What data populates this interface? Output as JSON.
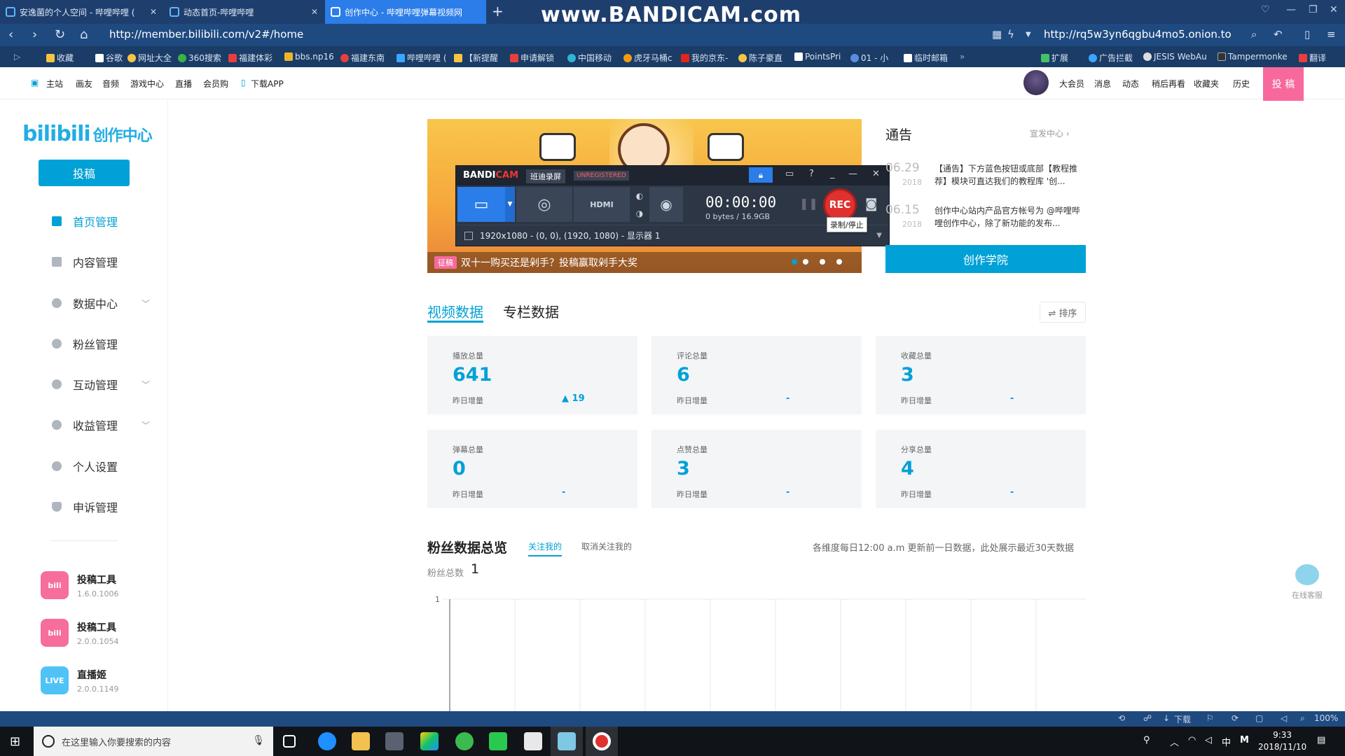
{
  "browser": {
    "watermark": "www.BANDICAM.com",
    "tabs": [
      {
        "label": "安逸菌的个人空间 - 哔哩哔哩 (",
        "active": false
      },
      {
        "label": "动态首页-哔哩哔哩",
        "active": false
      },
      {
        "label": "创作中心 - 哔哩哔哩弹幕视频网",
        "active": true
      }
    ],
    "new_tab": "+",
    "url": "http://member.bilibili.com/v2#/home",
    "right_url": "http://rq5w3yn6qgbu4mo5.onion.to",
    "bookmarks": [
      "收藏",
      "谷歌",
      "网址大全",
      "360搜索",
      "福建体彩",
      "bbs.np16",
      "福建东南",
      "哔哩哔哩 (",
      "【新提醒",
      "申请解锁",
      "中国移动",
      "虎牙马桶c",
      "我的京东-",
      "陈子豪直",
      "PointsPri",
      "01 - 小",
      "临时邮箱"
    ],
    "bookmarks_right": [
      "扩展",
      "广告拦截",
      "JESIS WebAu",
      "Tampermonke",
      "翻译"
    ]
  },
  "site_nav": {
    "left": [
      "主站",
      "画友",
      "音频",
      "游戏中心",
      "直播",
      "会员购",
      "下载APP"
    ],
    "right": [
      "大会员",
      "消息",
      "动态",
      "稍后再看",
      "收藏夹",
      "历史"
    ],
    "upload": "投 稿"
  },
  "sidebar": {
    "logo": "bilibili",
    "logo_sub": "创作中心",
    "post_button": "投稿",
    "menu": [
      {
        "label": "首页管理",
        "icon": "home-icon",
        "active": true,
        "expandable": false
      },
      {
        "label": "内容管理",
        "icon": "document-icon",
        "active": false,
        "expandable": false
      },
      {
        "label": "数据中心",
        "icon": "chart-icon",
        "active": false,
        "expandable": true
      },
      {
        "label": "粉丝管理",
        "icon": "fans-icon",
        "active": false,
        "expandable": false
      },
      {
        "label": "互动管理",
        "icon": "chat-icon",
        "active": false,
        "expandable": true
      },
      {
        "label": "收益管理",
        "icon": "coin-icon",
        "active": false,
        "expandable": true
      },
      {
        "label": "个人设置",
        "icon": "gear-icon",
        "active": false,
        "expandable": false
      },
      {
        "label": "申诉管理",
        "icon": "shield-icon",
        "active": false,
        "expandable": false
      }
    ],
    "tools": [
      {
        "name": "投稿工具",
        "version": "1.6.0.1006"
      },
      {
        "name": "投稿工具",
        "version": "2.0.0.1054"
      },
      {
        "name": "直播姬",
        "version": "2.0.0.1149"
      }
    ]
  },
  "banner": {
    "tag": "征稿",
    "caption": "双十一购买还是剁手？投稿赢取剁手大奖"
  },
  "bandicam": {
    "brand_a": "BANDI",
    "brand_b": "CAM",
    "mode": "班迪录屏",
    "unregistered": "UNREGISTERED",
    "timer": "00:00:00",
    "size": "0 bytes / 16.9GB",
    "rec": "REC",
    "tooltip": "录制/停止",
    "region": "1920x1080 - (0, 0), (1920, 1080) - 显示器 1",
    "hdmi": "HDMI"
  },
  "notice": {
    "title": "通告",
    "more": "宣发中心",
    "items": [
      {
        "date": "06.29",
        "year": "2018",
        "text": "【通告】下方蓝色按钮或底部【教程推荐】模块可直达我们的教程库 '创..."
      },
      {
        "date": "06.15",
        "year": "2018",
        "text": "创作中心站内产品官方帐号为 @哔哩哔哩创作中心，除了新功能的发布..."
      }
    ],
    "academy": "创作学院"
  },
  "data_tabs": [
    "视频数据",
    "专栏数据"
  ],
  "sort_label": "⇌ 排序",
  "stats": [
    {
      "label": "播放总量",
      "value": "641",
      "sub": "昨日增量",
      "delta": "▲ 19"
    },
    {
      "label": "评论总量",
      "value": "6",
      "sub": "昨日增量",
      "delta": "-"
    },
    {
      "label": "收藏总量",
      "value": "3",
      "sub": "昨日增量",
      "delta": "-"
    },
    {
      "label": "弹幕总量",
      "value": "0",
      "sub": "昨日增量",
      "delta": "-"
    },
    {
      "label": "点赞总量",
      "value": "3",
      "sub": "昨日增量",
      "delta": "-"
    },
    {
      "label": "分享总量",
      "value": "4",
      "sub": "昨日增量",
      "delta": "-"
    }
  ],
  "fans": {
    "title": "粉丝数据总览",
    "tab_follow": "关注我的",
    "tab_unfollow": "取消关注我的",
    "note": "各维度每日12:00 a.m 更新前一日数据，此处展示最近30天数据",
    "total_label": "粉丝总数",
    "total_value": "1",
    "y_tick": "1"
  },
  "service": "在线客服",
  "statusbar": {
    "download": "下载",
    "zoom": "100%"
  },
  "taskbar": {
    "search_placeholder": "在这里输入你要搜索的内容",
    "time": "9:33",
    "date": "2018/11/10",
    "ime": "中",
    "ime2": "M"
  },
  "colors": {
    "accent": "#00a1d6",
    "pink": "#f7699c",
    "tab_active": "#2b7de9",
    "rec": "#e0312e"
  }
}
